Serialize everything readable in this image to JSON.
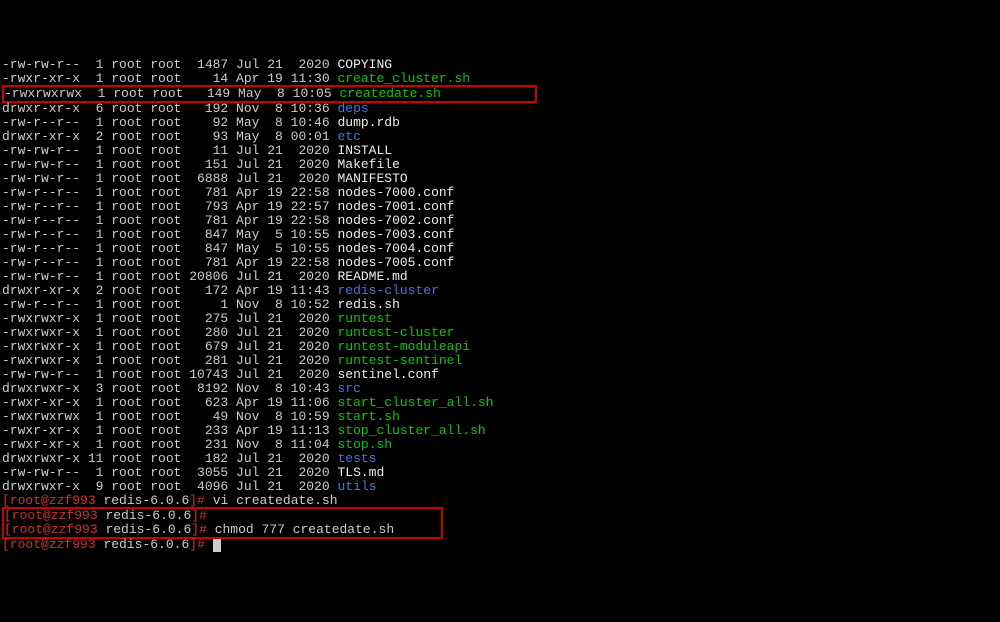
{
  "lines": [
    {
      "perms": "-rw-rw-r--",
      "links": "1",
      "owner": "root",
      "group": "root",
      "size": "1487",
      "date": "Jul 21  2020",
      "name": "COPYING",
      "nameClass": "white"
    },
    {
      "perms": "-rwxr-xr-x",
      "links": "1",
      "owner": "root",
      "group": "root",
      "size": "14",
      "date": "Apr 19 11:30",
      "name": "create_cluster.sh",
      "nameClass": "green"
    },
    {
      "perms": "-rwxrwxrwx",
      "links": "1",
      "owner": "root",
      "group": "root",
      "size": "149",
      "date": "May  8 10:05",
      "name": "createdate.sh",
      "nameClass": "green",
      "boxed": true
    },
    {
      "perms": "drwxr-xr-x",
      "links": "6",
      "owner": "root",
      "group": "root",
      "size": "192",
      "date": "Nov  8 10:36",
      "name": "deps",
      "nameClass": "blue"
    },
    {
      "perms": "-rw-r--r--",
      "links": "1",
      "owner": "root",
      "group": "root",
      "size": "92",
      "date": "May  8 10:46",
      "name": "dump.rdb",
      "nameClass": "white"
    },
    {
      "perms": "drwxr-xr-x",
      "links": "2",
      "owner": "root",
      "group": "root",
      "size": "93",
      "date": "May  8 00:01",
      "name": "etc",
      "nameClass": "blue"
    },
    {
      "perms": "-rw-rw-r--",
      "links": "1",
      "owner": "root",
      "group": "root",
      "size": "11",
      "date": "Jul 21  2020",
      "name": "INSTALL",
      "nameClass": "white"
    },
    {
      "perms": "-rw-rw-r--",
      "links": "1",
      "owner": "root",
      "group": "root",
      "size": "151",
      "date": "Jul 21  2020",
      "name": "Makefile",
      "nameClass": "white"
    },
    {
      "perms": "-rw-rw-r--",
      "links": "1",
      "owner": "root",
      "group": "root",
      "size": "6888",
      "date": "Jul 21  2020",
      "name": "MANIFESTO",
      "nameClass": "white"
    },
    {
      "perms": "-rw-r--r--",
      "links": "1",
      "owner": "root",
      "group": "root",
      "size": "781",
      "date": "Apr 19 22:58",
      "name": "nodes-7000.conf",
      "nameClass": "white"
    },
    {
      "perms": "-rw-r--r--",
      "links": "1",
      "owner": "root",
      "group": "root",
      "size": "793",
      "date": "Apr 19 22:57",
      "name": "nodes-7001.conf",
      "nameClass": "white"
    },
    {
      "perms": "-rw-r--r--",
      "links": "1",
      "owner": "root",
      "group": "root",
      "size": "781",
      "date": "Apr 19 22:58",
      "name": "nodes-7002.conf",
      "nameClass": "white"
    },
    {
      "perms": "-rw-r--r--",
      "links": "1",
      "owner": "root",
      "group": "root",
      "size": "847",
      "date": "May  5 10:55",
      "name": "nodes-7003.conf",
      "nameClass": "white"
    },
    {
      "perms": "-rw-r--r--",
      "links": "1",
      "owner": "root",
      "group": "root",
      "size": "847",
      "date": "May  5 10:55",
      "name": "nodes-7004.conf",
      "nameClass": "white"
    },
    {
      "perms": "-rw-r--r--",
      "links": "1",
      "owner": "root",
      "group": "root",
      "size": "781",
      "date": "Apr 19 22:58",
      "name": "nodes-7005.conf",
      "nameClass": "white"
    },
    {
      "perms": "-rw-rw-r--",
      "links": "1",
      "owner": "root",
      "group": "root",
      "size": "20806",
      "date": "Jul 21  2020",
      "name": "README.md",
      "nameClass": "white"
    },
    {
      "perms": "drwxr-xr-x",
      "links": "2",
      "owner": "root",
      "group": "root",
      "size": "172",
      "date": "Apr 19 11:43",
      "name": "redis-cluster",
      "nameClass": "blue"
    },
    {
      "perms": "-rw-r--r--",
      "links": "1",
      "owner": "root",
      "group": "root",
      "size": "1",
      "date": "Nov  8 10:52",
      "name": "redis.sh",
      "nameClass": "white"
    },
    {
      "perms": "-rwxrwxr-x",
      "links": "1",
      "owner": "root",
      "group": "root",
      "size": "275",
      "date": "Jul 21  2020",
      "name": "runtest",
      "nameClass": "green"
    },
    {
      "perms": "-rwxrwxr-x",
      "links": "1",
      "owner": "root",
      "group": "root",
      "size": "280",
      "date": "Jul 21  2020",
      "name": "runtest-cluster",
      "nameClass": "green"
    },
    {
      "perms": "-rwxrwxr-x",
      "links": "1",
      "owner": "root",
      "group": "root",
      "size": "679",
      "date": "Jul 21  2020",
      "name": "runtest-moduleapi",
      "nameClass": "green"
    },
    {
      "perms": "-rwxrwxr-x",
      "links": "1",
      "owner": "root",
      "group": "root",
      "size": "281",
      "date": "Jul 21  2020",
      "name": "runtest-sentinel",
      "nameClass": "green"
    },
    {
      "perms": "-rw-rw-r--",
      "links": "1",
      "owner": "root",
      "group": "root",
      "size": "10743",
      "date": "Jul 21  2020",
      "name": "sentinel.conf",
      "nameClass": "white"
    },
    {
      "perms": "drwxrwxr-x",
      "links": "3",
      "owner": "root",
      "group": "root",
      "size": "8192",
      "date": "Nov  8 10:43",
      "name": "src",
      "nameClass": "blue"
    },
    {
      "perms": "-rwxr-xr-x",
      "links": "1",
      "owner": "root",
      "group": "root",
      "size": "623",
      "date": "Apr 19 11:06",
      "name": "start_cluster_all.sh",
      "nameClass": "green"
    },
    {
      "perms": "-rwxrwxrwx",
      "links": "1",
      "owner": "root",
      "group": "root",
      "size": "49",
      "date": "Nov  8 10:59",
      "name": "start.sh",
      "nameClass": "green"
    },
    {
      "perms": "-rwxr-xr-x",
      "links": "1",
      "owner": "root",
      "group": "root",
      "size": "233",
      "date": "Apr 19 11:13",
      "name": "stop_cluster_all.sh",
      "nameClass": "green"
    },
    {
      "perms": "-rwxr-xr-x",
      "links": "1",
      "owner": "root",
      "group": "root",
      "size": "231",
      "date": "Nov  8 11:04",
      "name": "stop.sh",
      "nameClass": "green"
    },
    {
      "perms": "drwxrwxr-x",
      "links": "11",
      "owner": "root",
      "group": "root",
      "size": "182",
      "date": "Jul 21  2020",
      "name": "tests",
      "nameClass": "blue"
    },
    {
      "perms": "-rw-rw-r--",
      "links": "1",
      "owner": "root",
      "group": "root",
      "size": "3055",
      "date": "Jul 21  2020",
      "name": "TLS.md",
      "nameClass": "white"
    },
    {
      "perms": "drwxrwxr-x",
      "links": "9",
      "owner": "root",
      "group": "root",
      "size": "4096",
      "date": "Jul 21  2020",
      "name": "utils",
      "nameClass": "blue"
    }
  ],
  "prompts": [
    {
      "user": "root",
      "host": "zzf993",
      "dir": "redis-6.0.6",
      "cmd": "vi createdate.sh"
    },
    {
      "user": "root",
      "host": "zzf993",
      "dir": "redis-6.0.6",
      "cmd": ""
    },
    {
      "user": "root",
      "host": "zzf993",
      "dir": "redis-6.0.6",
      "cmd": "chmod 777 createdate.sh"
    },
    {
      "user": "root",
      "host": "zzf993",
      "dir": "redis-6.0.6",
      "cmd": "",
      "cursor": true
    }
  ]
}
